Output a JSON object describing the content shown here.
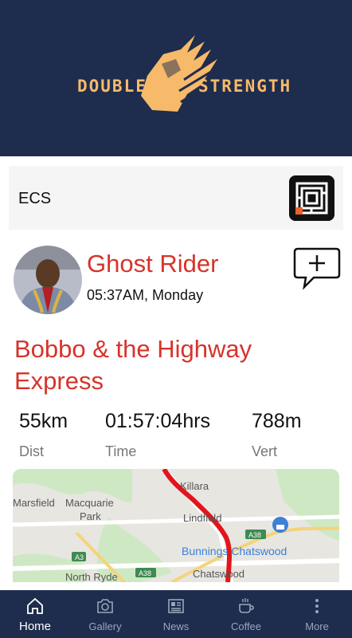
{
  "brand": {
    "word_left": "DOUBLE",
    "word_right": "STRENGTH"
  },
  "club": {
    "name": "ECS"
  },
  "post": {
    "rider": "Ghost Rider",
    "timestamp": "05:37AM, Monday",
    "title": "Bobbo & the Highway Express",
    "stats": [
      {
        "value": "55km",
        "label": "Dist"
      },
      {
        "value": "01:57:04hrs",
        "label": "Time"
      },
      {
        "value": "788m",
        "label": "Vert"
      }
    ]
  },
  "map": {
    "labels": [
      "Killara",
      "Lindfield",
      "Marsfield",
      "Macquarie",
      "Park",
      "A38",
      "Bunnings Chatswood",
      "Chatswood",
      "A3",
      "North Ryde",
      "A38"
    ],
    "route_color": "#e3141b"
  },
  "nav": {
    "items": [
      {
        "label": "Home",
        "icon": "home-icon",
        "active": true
      },
      {
        "label": "Gallery",
        "icon": "camera-icon"
      },
      {
        "label": "News",
        "icon": "newspaper-icon"
      },
      {
        "label": "Coffee",
        "icon": "coffee-icon"
      },
      {
        "label": "More",
        "icon": "more-icon"
      }
    ]
  },
  "colors": {
    "header_bg": "#1e2c4d",
    "accent": "#d7332b",
    "logo": "#f7b96a"
  }
}
